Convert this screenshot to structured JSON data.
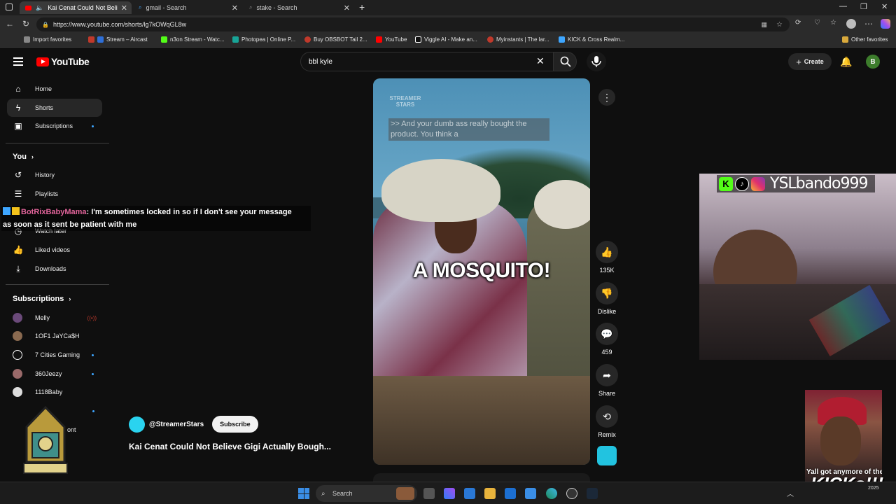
{
  "browser": {
    "tabs": [
      {
        "label": "Kai Cenat Could Not Believe",
        "active": true
      },
      {
        "label": "gmail - Search",
        "active": false
      },
      {
        "label": "stake - Search",
        "active": false
      }
    ],
    "url": "https://www.youtube.com/shorts/lg7kOWqGL8w",
    "bookmarks": [
      {
        "label": "Import favorites",
        "color": "#888888"
      },
      {
        "label": "Stream – Aircast",
        "color": "#2e6fd8"
      },
      {
        "label": "n3on Stream - Watc...",
        "color": "#53fc18"
      },
      {
        "label": "Photopea | Online P...",
        "color": "#18a497"
      },
      {
        "label": "Buy OBSBOT Tail 2...",
        "color": "#c0392b"
      },
      {
        "label": "YouTube",
        "color": "#ff0000"
      },
      {
        "label": "Viggle AI - Make an...",
        "color": "#ffffff"
      },
      {
        "label": "Myinstants | The lar...",
        "color": "#c0392b"
      },
      {
        "label": "KICK & Cross Realm...",
        "color": "#3ea6ff"
      }
    ],
    "other_favorites": "Other favorites"
  },
  "youtube": {
    "logo_text": "YouTube",
    "search_value": "bbl kyle",
    "create_label": "Create",
    "avatar_letter": "B"
  },
  "sidebar": {
    "main": [
      {
        "label": "Home",
        "icon": "home-icon"
      },
      {
        "label": "Shorts",
        "icon": "shorts-icon"
      },
      {
        "label": "Subscriptions",
        "icon": "subscriptions-icon"
      }
    ],
    "you_heading": "You",
    "you_items": [
      {
        "label": "History",
        "icon": "history-icon"
      },
      {
        "label": "Playlists",
        "icon": "playlists-icon"
      },
      {
        "label": "Watch later",
        "icon": "watch-later-icon"
      },
      {
        "label": "Liked videos",
        "icon": "like-icon"
      },
      {
        "label": "Downloads",
        "icon": "download-icon"
      }
    ],
    "subs_heading": "Subscriptions",
    "subscriptions": [
      {
        "label": "Melly",
        "color": "#6b4a7a"
      },
      {
        "label": "1OF1 JaYCa$H",
        "color": "#8a6a50"
      },
      {
        "label": "7 Cities Gaming",
        "color": "#ffffff"
      },
      {
        "label": "360Jeezy",
        "color": "#9a6a6a"
      },
      {
        "label": "1118Baby",
        "color": "#dddddd"
      },
      {
        "label": "ont",
        "color": "#666666"
      }
    ]
  },
  "short": {
    "watermark": "STREAMER STARS",
    "caption_top": ">> And your dumb ass really bought the product. You think a",
    "caption_main": "A MOSQUITO!",
    "likes": "135K",
    "dislike_label": "Dislike",
    "comments": "459",
    "share_label": "Share",
    "remix_label": "Remix",
    "channel": "@StreamerStars",
    "subscribe_label": "Subscribe",
    "title": "Kai Cenat Could Not Believe Gigi Actually Bough..."
  },
  "chat": {
    "user": "BotRixBabyMama",
    "message": ": I'm sometimes locked in so if I don't see your message",
    "message2": "as soon as it sent be patient with me"
  },
  "stream": {
    "handle": "YSLbando999",
    "meme_caption": "Yall got anymore of them",
    "meme_big": "KICKs!!!"
  },
  "taskbar": {
    "search_label": "Search",
    "year": "2025"
  }
}
